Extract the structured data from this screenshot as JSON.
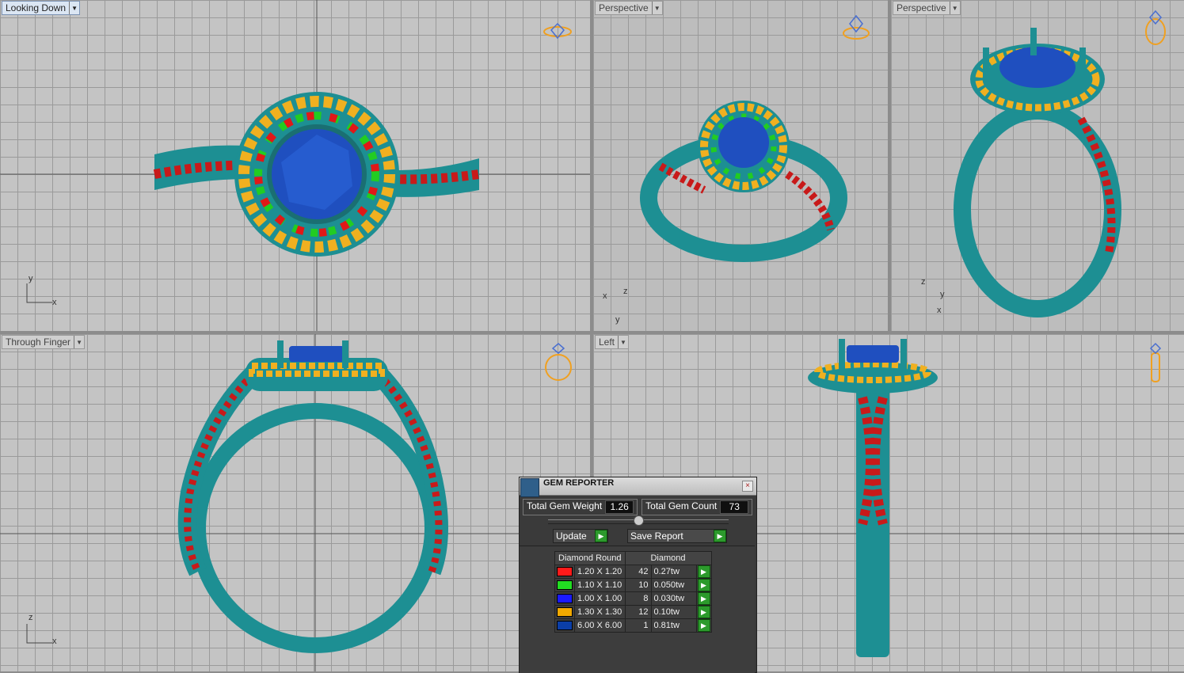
{
  "viewports": {
    "top_left": {
      "label": "Looking Down",
      "axes": [
        "y",
        "x"
      ]
    },
    "top_mid": {
      "label": "Perspective",
      "axes": [
        "x",
        "z",
        "y"
      ]
    },
    "top_right": {
      "label": "Perspective",
      "axes": [
        "z",
        "y",
        "x"
      ]
    },
    "bottom_left": {
      "label": "Through Finger",
      "axes": [
        "z",
        "x"
      ]
    },
    "bottom_right": {
      "label": "Left"
    }
  },
  "gem_reporter": {
    "title": "GEM REPORTER",
    "close": "×",
    "total_weight_label": "Total Gem Weight",
    "total_weight_value": "1.26",
    "total_count_label": "Total Gem Count",
    "total_count_value": "73",
    "update_label": "Update",
    "save_label": "Save Report",
    "table_headers": [
      "Diamond Round",
      "Diamond"
    ],
    "rows": [
      {
        "color": "#ff1a1a",
        "size": "1.20 X 1.20",
        "count": "42",
        "weight": "0.27tw"
      },
      {
        "color": "#22dd22",
        "size": "1.10 X 1.10",
        "count": "10",
        "weight": "0.050tw"
      },
      {
        "color": "#1a1aff",
        "size": "1.00 X 1.00",
        "count": "8",
        "weight": "0.030tw"
      },
      {
        "color": "#f2a900",
        "size": "1.30 X 1.30",
        "count": "12",
        "weight": "0.10tw"
      },
      {
        "color": "#0b3ea8",
        "size": "6.00 X 6.00",
        "count": "1",
        "weight": "0.81tw"
      }
    ]
  },
  "colors": {
    "metal": "#1d8f93",
    "center_stone": "#1f4fbf",
    "accent_orange": "#f0a020"
  }
}
